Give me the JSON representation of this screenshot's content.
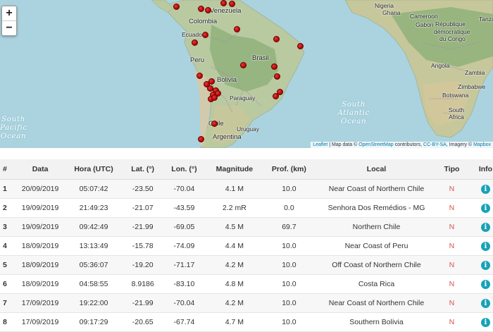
{
  "map": {
    "zoom_in_label": "+",
    "zoom_out_label": "−",
    "ocean_labels": {
      "south_pacific": [
        "South",
        "Pacific",
        "Ocean"
      ],
      "south_atlantic": [
        "South",
        "Atlantic",
        "Ocean"
      ]
    },
    "country_labels": {
      "nigeria": "Nigeria",
      "ghana": "Ghana",
      "cameroon": "Cameroon",
      "gabon": "Gabon",
      "dr_congo": "République",
      "dr_congo2": "démocratique",
      "dr_congo3": "du Congo",
      "colombia": "Colombia",
      "venezuela": "Venezuela",
      "ecuador": "Ecuador",
      "peru": "Peru",
      "brasil": "Brasil",
      "bolivia": "Bolivia",
      "paraguay": "Paraguay",
      "chile": "Chile",
      "argentina": "Argentina",
      "uruguay": "Uruguay",
      "angola": "Angola",
      "zambia": "Zambia",
      "zimbabwe": "Zimbabwe",
      "botswana": "Botswana",
      "south_africa": "South Africa",
      "tanzania": "Tanzania"
    },
    "attribution": {
      "leaflet": "Leaflet",
      "sep1": " | Map data © ",
      "osm": "OpenStreetMap",
      "mid": " contributors, ",
      "license": "CC-BY-SA",
      "imagery": ", Imagery © ",
      "mapbox": "Mapbox"
    }
  },
  "table": {
    "headers": [
      "#",
      "Data",
      "Hora (UTC)",
      "Lat. (°)",
      "Lon. (°)",
      "Magnitude",
      "Prof. (km)",
      "Local",
      "Tipo",
      "Info"
    ],
    "rows": [
      [
        "1",
        "20/09/2019",
        "05:07:42",
        "-23.50",
        "-70.04",
        "4.1 M",
        "10.0",
        "Near Coast of Northern Chile",
        "N"
      ],
      [
        "2",
        "19/09/2019",
        "21:49:23",
        "-21.07",
        "-43.59",
        "2.2 mR",
        "0.0",
        "Senhora Dos Remédios - MG",
        "N"
      ],
      [
        "3",
        "19/09/2019",
        "09:42:49",
        "-21.99",
        "-69.05",
        "4.5 M",
        "69.7",
        "Northern Chile",
        "N"
      ],
      [
        "4",
        "18/09/2019",
        "13:13:49",
        "-15.78",
        "-74.09",
        "4.4 M",
        "10.0",
        "Near Coast of Peru",
        "N"
      ],
      [
        "5",
        "18/09/2019",
        "05:36:07",
        "-19.20",
        "-71.17",
        "4.2 M",
        "10.0",
        "Off Coast of Northern Chile",
        "N"
      ],
      [
        "6",
        "18/09/2019",
        "04:58:55",
        "8.9186",
        "-83.10",
        "4.8 M",
        "10.0",
        "Costa Rica",
        "N"
      ],
      [
        "7",
        "17/09/2019",
        "19:22:00",
        "-21.99",
        "-70.04",
        "4.2 M",
        "10.0",
        "Near Coast of Northern Chile",
        "N"
      ],
      [
        "8",
        "17/09/2019",
        "09:17:29",
        "-20.65",
        "-67.74",
        "4.7 M",
        "10.0",
        "Southern Bolivia",
        "N"
      ]
    ],
    "info_icon": "i",
    "colors": {
      "tipo": "#d9534f",
      "info": "#17a2b8",
      "marker": "#c00000"
    }
  }
}
